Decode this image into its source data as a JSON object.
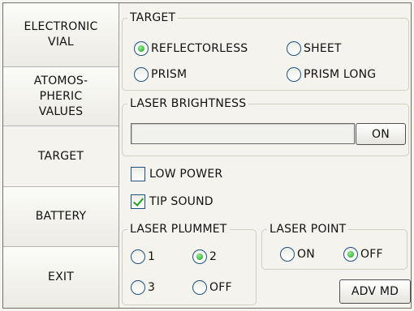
{
  "nav": {
    "items": [
      {
        "label": "ELECTRONIC\nVIAL"
      },
      {
        "label": "ATOMOS-\nPHERIC\nVALUES"
      },
      {
        "label": "TARGET"
      },
      {
        "label": "BATTERY"
      },
      {
        "label": "EXIT"
      }
    ]
  },
  "target": {
    "title": "TARGET",
    "options": {
      "reflectorless": "REFLECTORLESS",
      "sheet": "SHEET",
      "prism": "PRISM",
      "prism_long": "PRISM LONG"
    },
    "selected": "REFLECTORLESS"
  },
  "laser_brightness": {
    "title": "LASER BRIGHTNESS",
    "level": 0,
    "button": "ON"
  },
  "options": {
    "low_power": {
      "label": "LOW POWER",
      "checked": false
    },
    "tip_sound": {
      "label": "TIP SOUND",
      "checked": true
    }
  },
  "laser_plummet": {
    "title": "LASER PLUMMET",
    "options": {
      "o1": "1",
      "o2": "2",
      "o3": "3",
      "off": "OFF"
    },
    "selected": "2"
  },
  "laser_point": {
    "title": "LASER POINT",
    "options": {
      "on": "ON",
      "off": "OFF"
    },
    "selected": "OFF"
  },
  "adv_button": "ADV MD",
  "colors": {
    "radio_selected": "#1f9a2a",
    "control_border": "#1c5180",
    "background": "#f4f3ee"
  }
}
